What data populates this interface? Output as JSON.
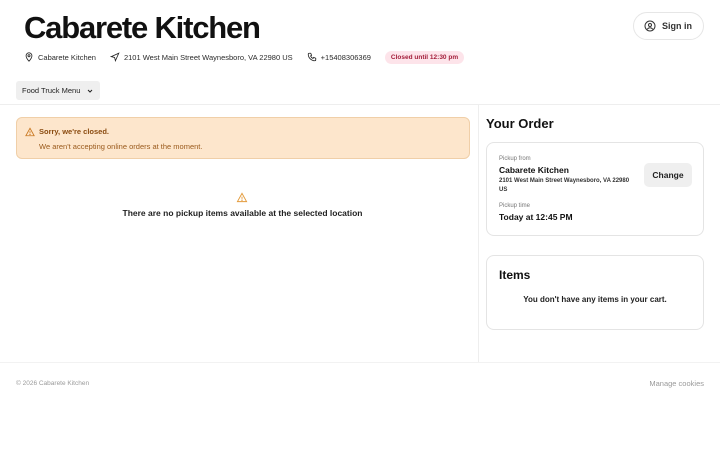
{
  "header": {
    "title": "Cabarete Kitchen",
    "signin_label": "Sign in"
  },
  "info": {
    "restaurant": "Cabarete Kitchen",
    "address": "2101 West Main Street Waynesboro, VA 22980 US",
    "phone": "+15408306369",
    "status_badge": "Closed until 12:30 pm"
  },
  "menu": {
    "selected": "Food Truck Menu"
  },
  "alert": {
    "title": "Sorry, we're closed.",
    "body": "We aren't accepting online orders at the moment."
  },
  "empty_state": {
    "text": "There are no pickup items available at the selected location"
  },
  "order": {
    "title": "Your Order",
    "pickup_from_label": "Pickup from",
    "pickup_name": "Cabarete Kitchen",
    "pickup_address": "2101 West Main Street Waynesboro, VA 22980 US",
    "pickup_time_label": "Pickup time",
    "pickup_time": "Today at 12:45 PM",
    "change_label": "Change"
  },
  "items": {
    "title": "Items",
    "empty": "You don't have any items in your cart."
  },
  "footer": {
    "copyright": "© 2026 Cabarete Kitchen",
    "manage_cookies": "Manage cookies"
  },
  "colors": {
    "alert_bg": "#fde6cc",
    "alert_text": "#8a4b10",
    "badge_bg": "#fde4ea",
    "badge_text": "#a31e3a",
    "warning_icon": "#e39a3a"
  }
}
